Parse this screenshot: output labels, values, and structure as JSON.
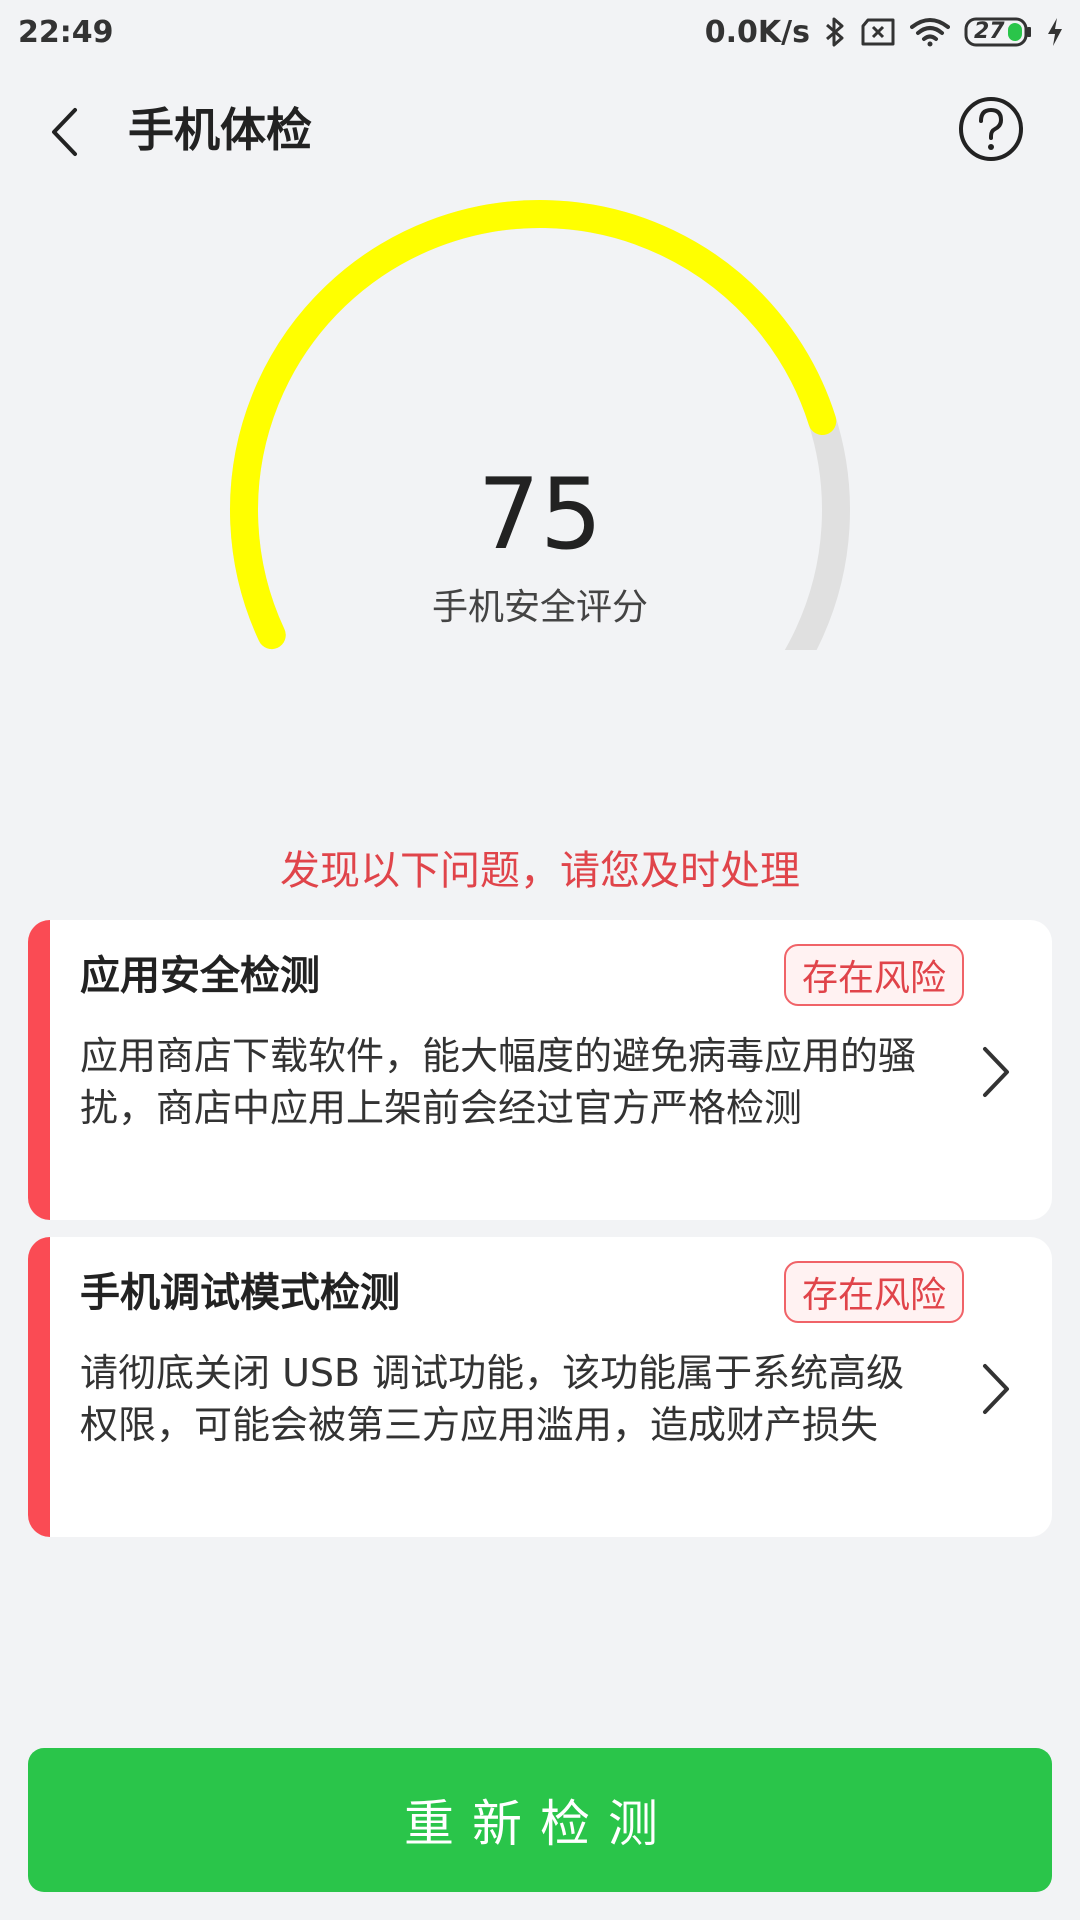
{
  "status_bar": {
    "time": "22:49",
    "net_speed": "0.0K/s",
    "battery": "27"
  },
  "header": {
    "title": "手机体检"
  },
  "gauge": {
    "score": "75",
    "label": "手机安全评分",
    "progress_percent": 75,
    "color_progress": "#ffff00",
    "color_track": "#e0e0e0"
  },
  "warning": {
    "text": "发现以下问题，请您及时处理"
  },
  "cards": [
    {
      "title": "应用安全检测",
      "badge": "存在风险",
      "desc": "应用商店下载软件，能大幅度的避免病毒应用的骚扰，商店中应用上架前会经过官方严格检测"
    },
    {
      "title": "手机调试模式检测",
      "badge": "存在风险",
      "desc": "请彻底关闭 USB 调试功能，该功能属于系统高级权限，可能会被第三方应用滥用，造成财产损失"
    }
  ],
  "button": {
    "label": "重新检测"
  },
  "colors": {
    "accent_red": "#fa4b54",
    "warning_red": "#e0444a",
    "button_green": "#2ac54a"
  }
}
